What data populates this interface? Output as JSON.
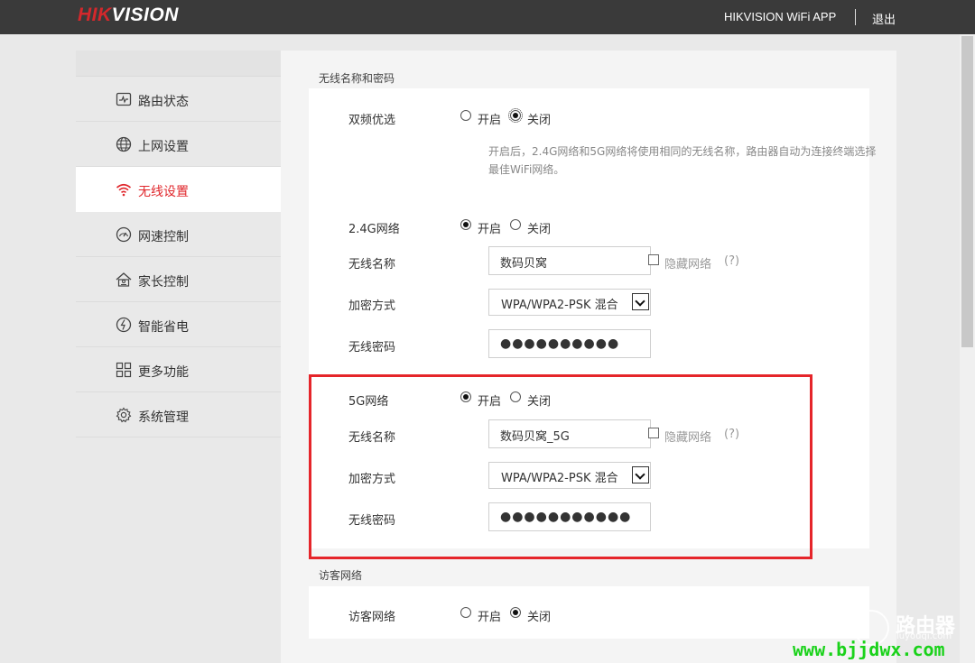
{
  "header": {
    "brand_red": "HIK",
    "brand_white": "VISION",
    "app_link": "HIKVISION WiFi APP",
    "logout": "退出"
  },
  "sidebar": {
    "items": [
      {
        "label": "路由状态",
        "icon": "monitor-icon"
      },
      {
        "label": "上网设置",
        "icon": "globe-icon"
      },
      {
        "label": "无线设置",
        "icon": "wifi-icon",
        "active": true
      },
      {
        "label": "网速控制",
        "icon": "speedometer-icon"
      },
      {
        "label": "家长控制",
        "icon": "house-icon"
      },
      {
        "label": "智能省电",
        "icon": "power-icon"
      },
      {
        "label": "更多功能",
        "icon": "grid-icon"
      },
      {
        "label": "系统管理",
        "icon": "gear-icon"
      }
    ]
  },
  "wireless": {
    "section_title": "无线名称和密码",
    "dual_band": {
      "label": "双频优选",
      "on_label": "开启",
      "off_label": "关闭",
      "selected": "off",
      "hint": "开启后，2.4G网络和5G网络将使用相同的无线名称，路由器自动为连接终端选择最佳WiFi网络。"
    },
    "band24": {
      "label": "2.4G网络",
      "on_label": "开启",
      "off_label": "关闭",
      "selected": "on",
      "ssid_label": "无线名称",
      "ssid": "数码贝窝",
      "hide_label": "隐藏网络",
      "help": "(?)",
      "enc_label": "加密方式",
      "enc": "WPA/WPA2-PSK 混合",
      "pwd_label": "无线密码",
      "pwd": "●●●●●●●●●●"
    },
    "band5": {
      "label": "5G网络",
      "on_label": "开启",
      "off_label": "关闭",
      "selected": "on",
      "ssid_label": "无线名称",
      "ssid": "数码贝窝_5G",
      "hide_label": "隐藏网络",
      "help": "(?)",
      "enc_label": "加密方式",
      "enc": "WPA/WPA2-PSK 混合",
      "pwd_label": "无线密码",
      "pwd": "●●●●●●●●●●●"
    }
  },
  "guest": {
    "section_title": "访客网络",
    "label": "访客网络",
    "on_label": "开启",
    "off_label": "关闭",
    "selected": "off"
  },
  "watermark": {
    "title": "路由器",
    "domain": "luyouqi.com",
    "url": "www.bjjdwx.com"
  },
  "colors": {
    "header_bg": "#3a3a3a",
    "brand_red": "#d4282c",
    "active_text": "#e0262b",
    "highlight_border": "#e5252a",
    "url_green": "#1ad21a"
  }
}
